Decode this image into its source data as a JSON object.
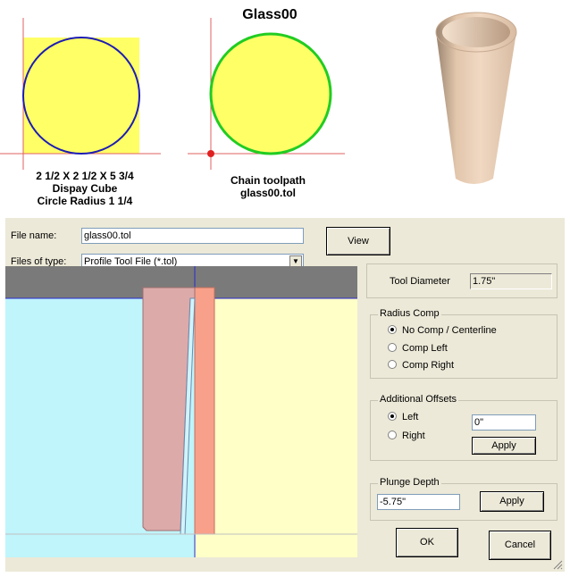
{
  "title": "Glass00",
  "captions": {
    "left": [
      "2 1/2 X 2 1/2 X 5 3/4",
      "Dispay Cube",
      "Circle Radius 1 1/4"
    ],
    "middle": [
      "Chain toolpath",
      "glass00.tol"
    ]
  },
  "colors": {
    "cube_fill": "#ffff66",
    "circle_stroke_left": "#1c1cb4",
    "circle_stroke_mid": "#22cc22",
    "axis": "#e06060",
    "cyl": "#e9cdb3"
  },
  "dialog": {
    "file_name_label": "File name:",
    "file_name_value": "glass00.tol",
    "files_of_type_label": "Files of type:",
    "files_of_type_value": "Profile Tool File (*.tol)",
    "view_button": "View",
    "tool_diameter_label": "Tool Diameter",
    "tool_diameter_value": "1.75\"",
    "radius_comp": {
      "title": "Radius Comp",
      "options": [
        "No Comp / Centerline",
        "Comp Left",
        "Comp Right"
      ],
      "selected": 0
    },
    "additional_offsets": {
      "title": "Additional Offsets",
      "options": [
        "Left",
        "Right"
      ],
      "selected": 0,
      "value": "0\"",
      "apply": "Apply"
    },
    "plunge_depth": {
      "title": "Plunge Depth",
      "value": "-5.75\"",
      "apply": "Apply"
    },
    "ok": "OK",
    "cancel": "Cancel"
  }
}
